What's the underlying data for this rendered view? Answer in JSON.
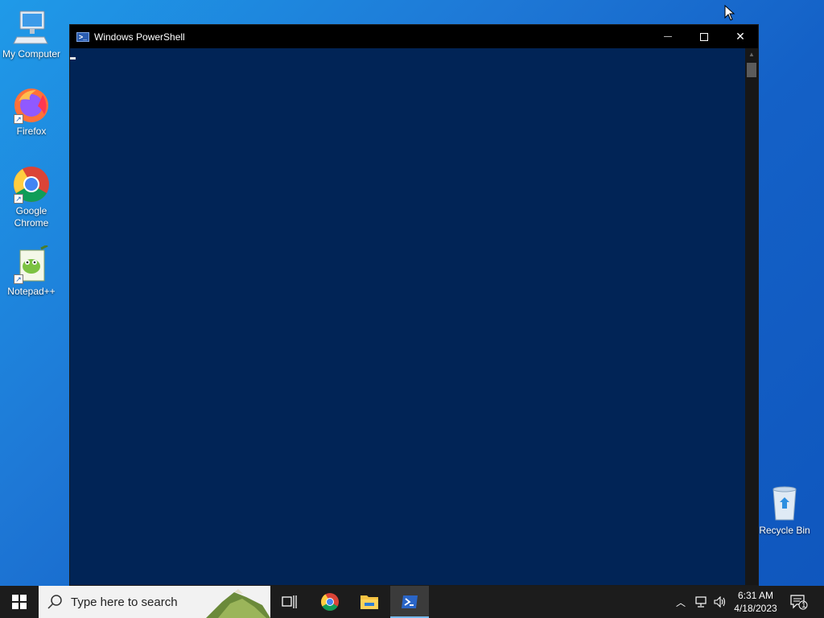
{
  "desktop": {
    "icons": [
      {
        "label": "My Computer",
        "icon": "computer-icon"
      },
      {
        "label": "Firefox",
        "icon": "firefox-icon"
      },
      {
        "label": "Google Chrome",
        "icon": "chrome-icon"
      },
      {
        "label": "Notepad++",
        "icon": "notepadpp-icon"
      },
      {
        "label": "Recycle Bin",
        "icon": "recycle-bin-icon"
      }
    ]
  },
  "window": {
    "title": "Windows PowerShell",
    "minimize_glyph": "—",
    "maximize_glyph": "☐",
    "close_glyph": "✕",
    "background_color": "#012456"
  },
  "taskbar": {
    "search_placeholder": "Type here to search",
    "pinned": [
      "task-view",
      "google-chrome",
      "file-explorer",
      "windows-powershell"
    ],
    "active_app": "windows-powershell"
  },
  "tray": {
    "time": "6:31 AM",
    "date": "4/18/2023",
    "notification_count": "1"
  }
}
